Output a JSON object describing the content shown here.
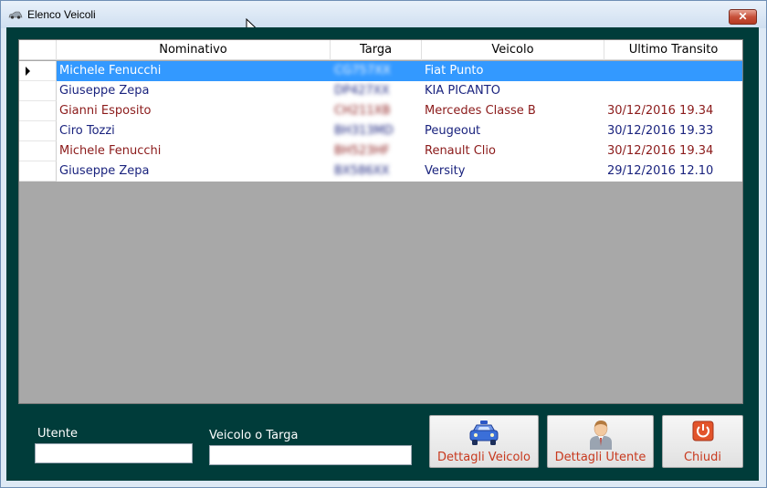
{
  "window": {
    "title": "Elenco Veicoli",
    "close_label": "✕"
  },
  "grid": {
    "columns": [
      "Nominativo",
      "Targa",
      "Veicolo",
      "Ultimo Transito"
    ],
    "selected_row": 0,
    "rows": [
      {
        "nominativo": "Michele Fenucchi",
        "targa": "CG757XX",
        "veicolo": "Fiat Punto",
        "transito": "",
        "color": "#ffffff"
      },
      {
        "nominativo": "Giuseppe Zepa",
        "targa": "DP427XX",
        "veicolo": "KIA PICANTO",
        "transito": "",
        "color": "#1a237e"
      },
      {
        "nominativo": "Gianni Esposito",
        "targa": "CH211XB",
        "veicolo": "Mercedes Classe B",
        "transito": "30/12/2016 19.34",
        "color": "#8b1a1a"
      },
      {
        "nominativo": "Ciro Tozzi",
        "targa": "BH313MD",
        "veicolo": "Peugeout",
        "transito": "30/12/2016 19.33",
        "color": "#1a237e"
      },
      {
        "nominativo": "Michele Fenucchi",
        "targa": "BH523HF",
        "veicolo": "Renault Clio",
        "transito": "30/12/2016 19.34",
        "color": "#8b1a1a"
      },
      {
        "nominativo": "Giuseppe Zepa",
        "targa": "BX586XX",
        "veicolo": "Versity",
        "transito": "29/12/2016 12.10",
        "color": "#1a237e"
      }
    ]
  },
  "filters": {
    "utente_label": "Utente",
    "utente_value": "",
    "veicolo_label": "Veicolo o Targa",
    "veicolo_value": ""
  },
  "buttons": {
    "dettagli_veicolo": "Dettagli Veicolo",
    "dettagli_utente": "Dettagli Utente",
    "chiudi": "Chiudi"
  },
  "icons": {
    "app": "car-icon",
    "dettagli_veicolo": "taxi-icon",
    "dettagli_utente": "user-icon",
    "chiudi": "power-icon"
  }
}
